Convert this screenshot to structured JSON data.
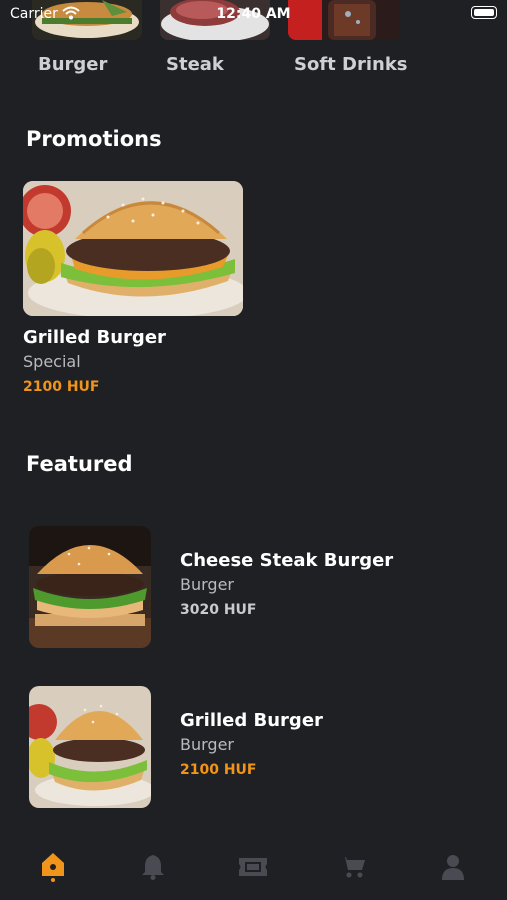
{
  "status_bar": {
    "carrier": "Carrier",
    "time": "12:40 AM"
  },
  "categories": [
    {
      "label": "Burger",
      "image": "burger-thumbnail"
    },
    {
      "label": "Steak",
      "image": "steak-thumbnail"
    },
    {
      "label": "Soft Drinks",
      "image": "soft-drinks-thumbnail"
    }
  ],
  "promotions": {
    "title": "Promotions",
    "items": [
      {
        "name": "Grilled Burger",
        "subtitle": "Special",
        "price": "2100 HUF",
        "price_color": "#f0941b"
      }
    ]
  },
  "featured": {
    "title": "Featured",
    "items": [
      {
        "name": "Cheese Steak Burger",
        "category": "Burger",
        "price": "3020 HUF",
        "price_color": "#c9c9ce"
      },
      {
        "name": "Grilled Burger",
        "category": "Burger",
        "price": "2100 HUF",
        "price_color": "#f0941b"
      }
    ]
  },
  "tab_bar": {
    "active_color": "#f0941b",
    "inactive_color": "#4a4b52",
    "tabs": [
      {
        "icon": "home-icon",
        "active": true
      },
      {
        "icon": "bell-icon",
        "active": false
      },
      {
        "icon": "ticket-icon",
        "active": false
      },
      {
        "icon": "cart-icon",
        "active": false
      },
      {
        "icon": "user-icon",
        "active": false
      }
    ]
  }
}
